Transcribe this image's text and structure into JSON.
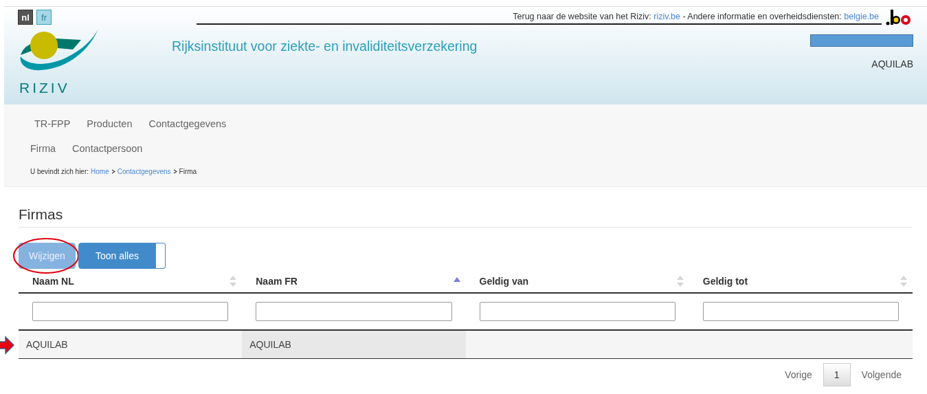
{
  "languages": [
    {
      "label": "nl",
      "selected": true
    },
    {
      "label": "fr",
      "selected": false
    }
  ],
  "top_links": {
    "text_1": "Terug naar de website van het Riziv:",
    "link_1": "riziv.be",
    "text_2": "- Andere informatie en overheidsdiensten:",
    "link_2": "belgie.be"
  },
  "logo_text": "RIZIV",
  "site_title": "Rijksinstituut voor ziekte- en invaliditeitsverzekering",
  "user": "AQUILAB",
  "nav_rows": [
    [
      "TR-FPP",
      "Producten",
      "Contactgegevens"
    ],
    [
      "Firma",
      "Contactpersoon"
    ]
  ],
  "breadcrumb": {
    "prefix": "U bevindt zich hier:",
    "links": [
      "Home",
      "Contactgegevens"
    ],
    "current": "Firma"
  },
  "page_title": "Firmas",
  "buttons": [
    {
      "label": "Wijzigen",
      "disabled": true
    },
    {
      "label": "Toon alles",
      "disabled": false
    }
  ],
  "table": {
    "columns": [
      {
        "label": "Naam NL",
        "sorted": false
      },
      {
        "label": "Naam FR",
        "sorted": true
      },
      {
        "label": "Geldig van",
        "sorted": false
      },
      {
        "label": "Geldig tot",
        "sorted": false
      }
    ],
    "rows": [
      [
        "AQUILAB",
        "AQUILAB",
        "",
        ""
      ]
    ]
  },
  "pagination": {
    "previous": "Vorige",
    "pages": [
      {
        "label": "1",
        "selected": true
      }
    ],
    "next": "Volgende"
  }
}
